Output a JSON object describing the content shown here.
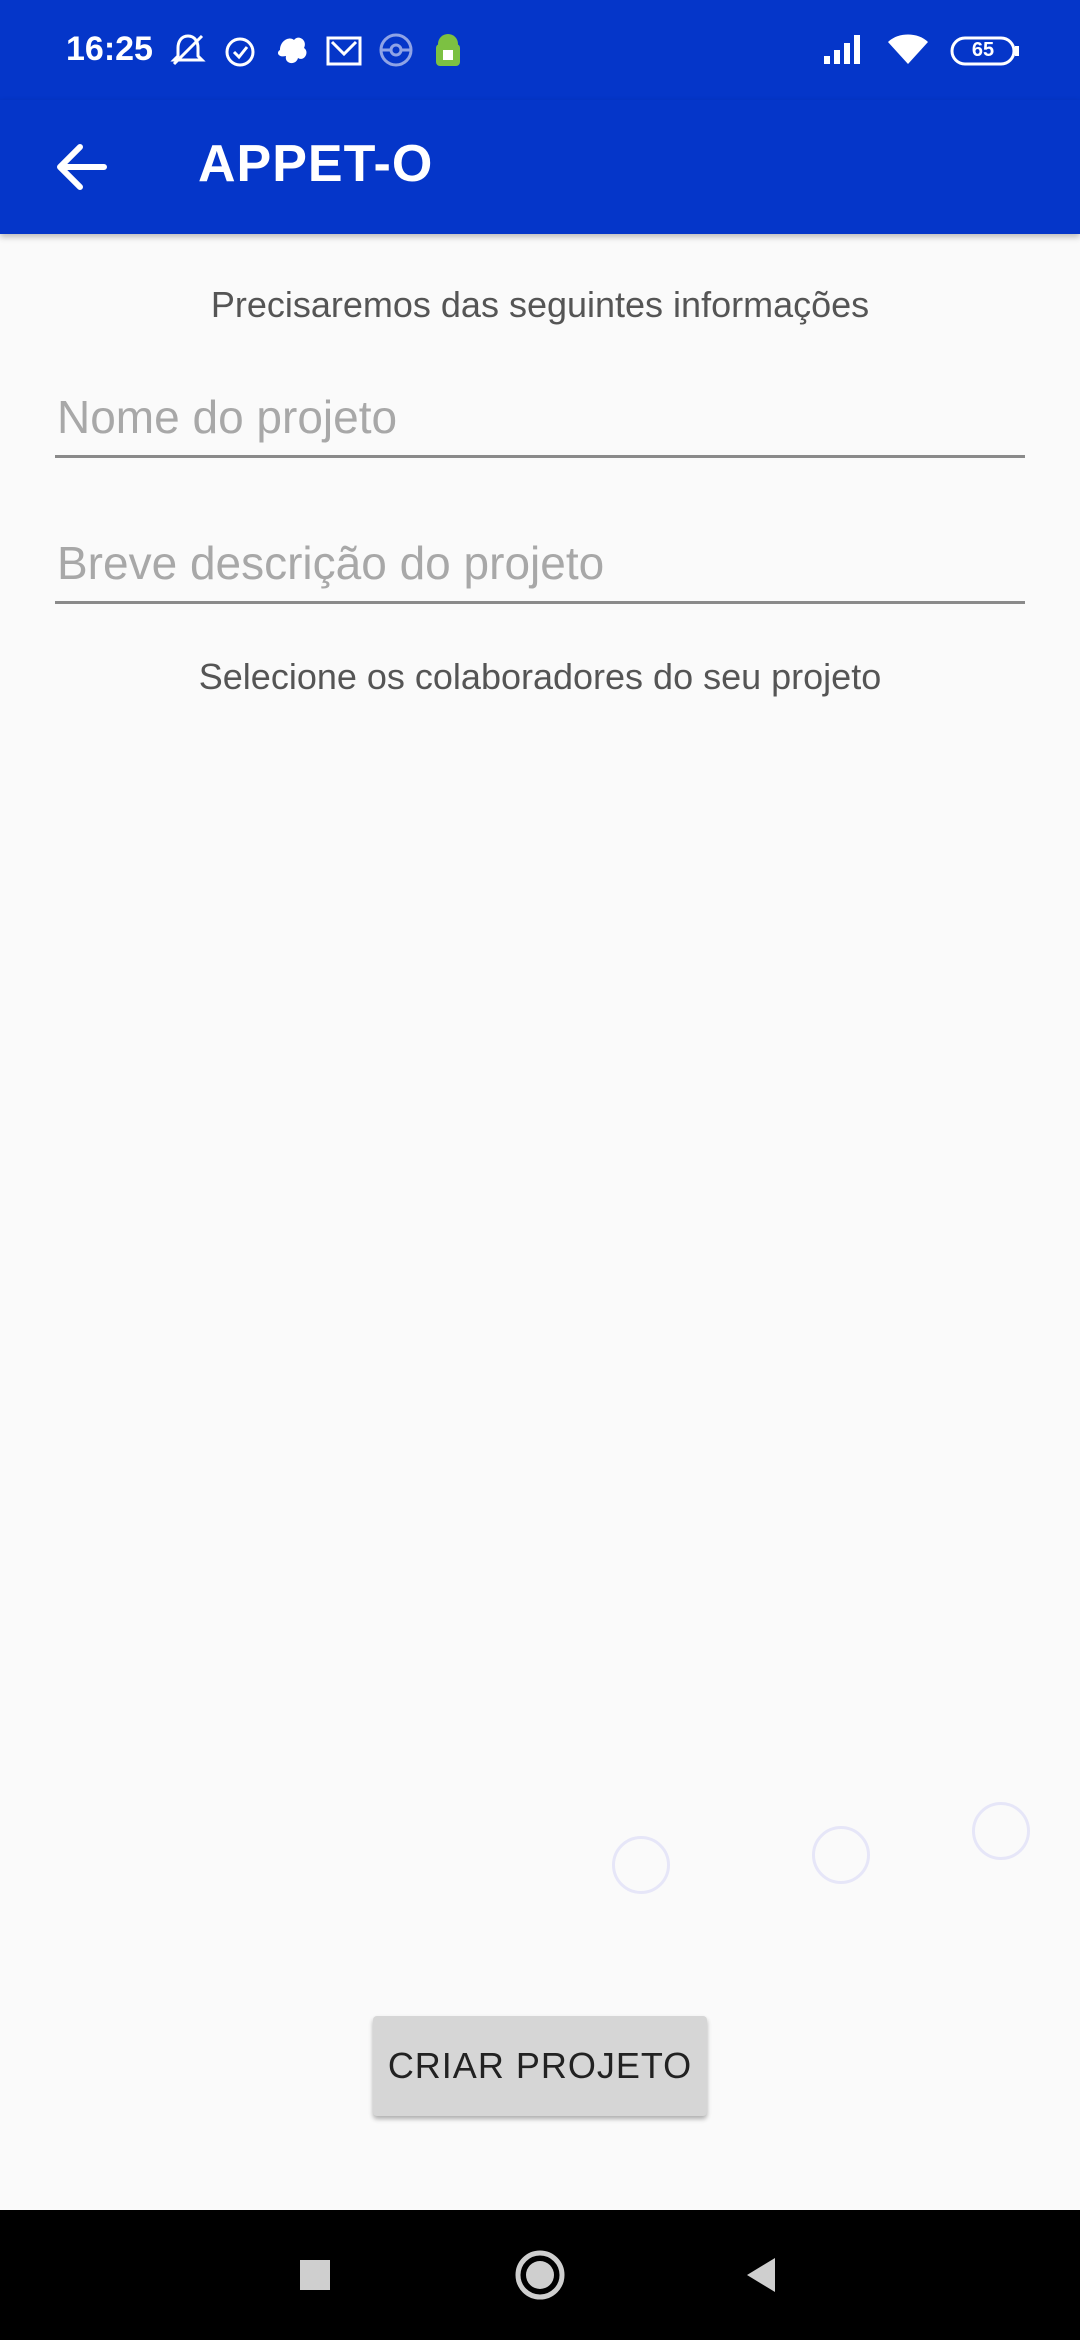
{
  "status_bar": {
    "time": "16:25",
    "battery": "65",
    "icons": [
      "mute-icon",
      "alarm-icon",
      "leaf-notification-icon",
      "mail-icon",
      "pokeball-icon",
      "android-icon",
      "signal-icon",
      "wifi-icon",
      "battery-icon"
    ]
  },
  "app_bar": {
    "title": "APPET-O"
  },
  "form": {
    "heading": "Precisaremos das seguintes informações",
    "name_placeholder": "Nome do projeto",
    "description_placeholder": "Breve descrição do projeto",
    "collaborators_label": "Selecione os colaboradores do seu projeto"
  },
  "create_button": {
    "label": "CRIAR PROJETO"
  },
  "colors": {
    "primary": "#0536c9",
    "background": "#fafafa",
    "button": "#d6d6d6"
  }
}
